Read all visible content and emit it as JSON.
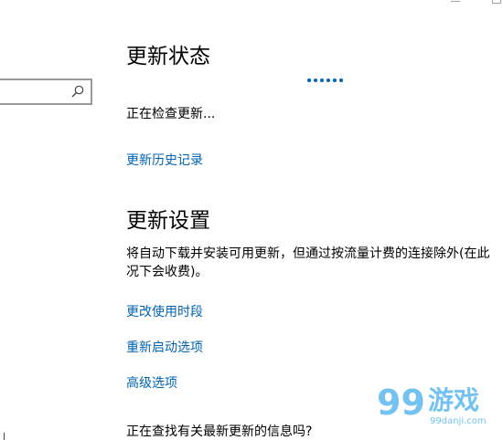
{
  "update_status": {
    "title": "更新状态",
    "status_text": "正在检查更新...",
    "history_link": "更新历史记录"
  },
  "update_settings": {
    "title": "更新设置",
    "description_line1": "将自动下载并安装可用更新，但通过按流量计费的连接除外(在此",
    "description_line2": "况下会收费)。",
    "links": [
      "更改使用时段",
      "重新启动选项",
      "高级选项"
    ]
  },
  "footer": {
    "question": "正在查找有关最新更新的信息吗?"
  },
  "watermark": {
    "brand": "游戏",
    "site": "99danji.com",
    "number": "99"
  },
  "colors": {
    "accent": "#0063b1",
    "watermark": "#5bb8f0"
  },
  "icons": {
    "search": "search-icon"
  }
}
